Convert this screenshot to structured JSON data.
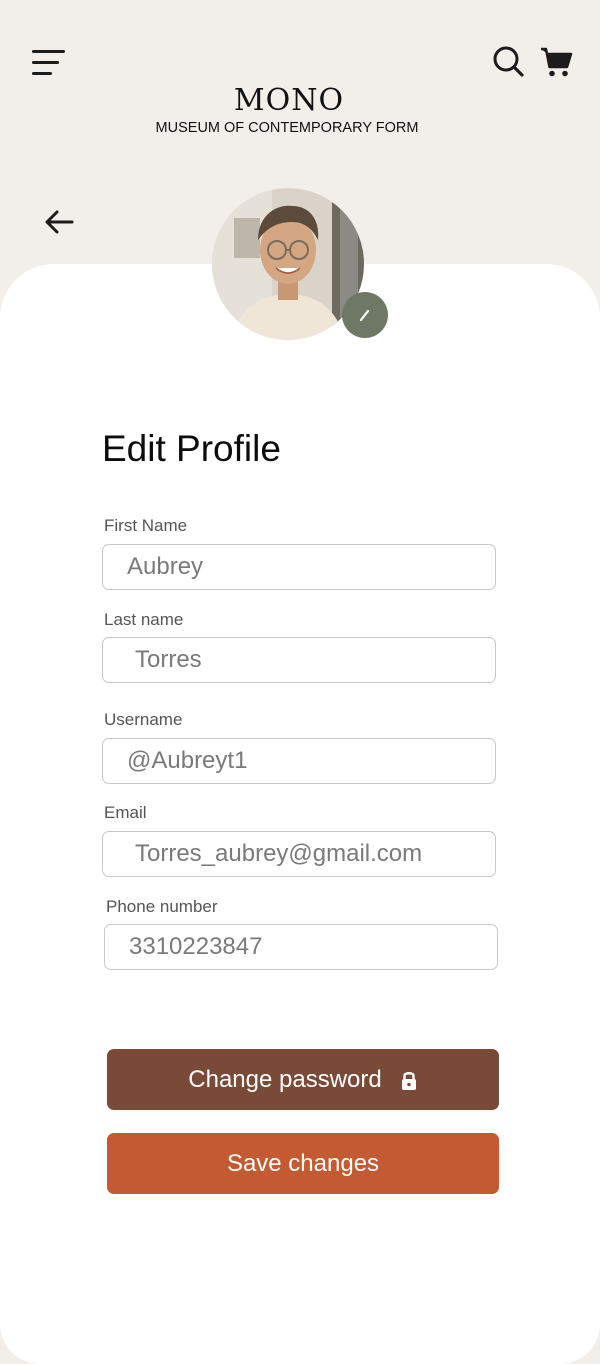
{
  "brand": {
    "name": "MONO",
    "subtitle": "MUSEUM OF CONTEMPORARY FORM"
  },
  "header": {
    "icons": [
      "menu-icon",
      "search-icon",
      "cart-icon"
    ]
  },
  "navigation": {
    "back_icon": "arrow-left-icon"
  },
  "profile": {
    "title": "Edit Profile",
    "avatar_edit_icon": "pencil-icon"
  },
  "form": {
    "first_name": {
      "label": "First Name",
      "value": "Aubrey"
    },
    "last_name": {
      "label": "Last name",
      "value": "Torres"
    },
    "username": {
      "label": "Username",
      "value": "@Aubreyt1"
    },
    "email": {
      "label": "Email",
      "value": "Torres_aubrey@gmail.com"
    },
    "phone": {
      "label": "Phone number",
      "value": "3310223847"
    }
  },
  "actions": {
    "change_password_label": "Change password",
    "change_password_icon": "lock-icon",
    "save_label": "Save changes"
  },
  "colors": {
    "background": "#f2efeb",
    "card": "#ffffff",
    "change_password_button": "#7a4a39",
    "save_button": "#c35a32",
    "avatar_edit_badge": "#6f7865"
  }
}
